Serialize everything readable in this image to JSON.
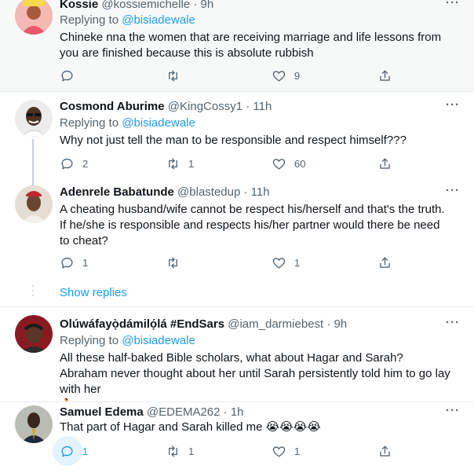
{
  "tweets": [
    {
      "name": "Kossie",
      "handle": "@kossiemichelle",
      "dot": "·",
      "time": "9h",
      "reply_prefix": "Replying to ",
      "reply_to": "@bisiadewale",
      "text": "Chineke nna the women that are receiving marriage and life lessons from you are finished because this is absolute rubbish",
      "replies": "",
      "retweets": "",
      "likes": "9",
      "avatar_color": "#f2b8b0"
    },
    {
      "name": "Cosmond Aburime",
      "handle": "@KingCossy1",
      "dot": "·",
      "time": "11h",
      "reply_prefix": "Replying to ",
      "reply_to": "@bisiadewale",
      "text": "Why not just tell the man to be responsible and respect himself???",
      "replies": "2",
      "retweets": "1",
      "likes": "60",
      "avatar_color": "#d9d9d9"
    },
    {
      "name": "Adenrele Babatunde",
      "handle": "@blastedup",
      "dot": "·",
      "time": "11h",
      "text": "A cheating husband/wife cannot be respect his/herself and that's the truth. If he/she is responsible and respects his/her partner would there be need to cheat?",
      "replies": "1",
      "retweets": "",
      "likes": "1",
      "avatar_color": "#d7c7b3"
    },
    {
      "name": "Olúwáfayọ̀dámilọ́lá #EndSars",
      "handle": "@iam_darmiebest",
      "dot": "·",
      "time": "9h",
      "reply_prefix": "Replying to ",
      "reply_to": "@bisiadewale",
      "text": "All these half-baked Bible scholars, what about Hagar and Sarah? Abraham never thought about her until Sarah persistently told him to go lay with her",
      "emoji_line": "🚶",
      "replies": "",
      "retweets": "",
      "likes": "",
      "avatar_color": "#8a1a22"
    },
    {
      "name": "Samuel Edema",
      "handle": "@EDEMA262",
      "dot": "·",
      "time": "1h",
      "text": "That part of Hagar and Sarah killed me ",
      "emoji_line": "😭😭😭😭",
      "replies": "1",
      "retweets": "1",
      "likes": "1",
      "avatar_color": "#6b6f6a"
    }
  ],
  "show_replies": "Show replies",
  "more_glyph": "···",
  "colors": {
    "accent": "#1d9bf0",
    "muted": "#536471",
    "border": "#e6ecf0",
    "highlight_bg": "#f7f9f9"
  }
}
